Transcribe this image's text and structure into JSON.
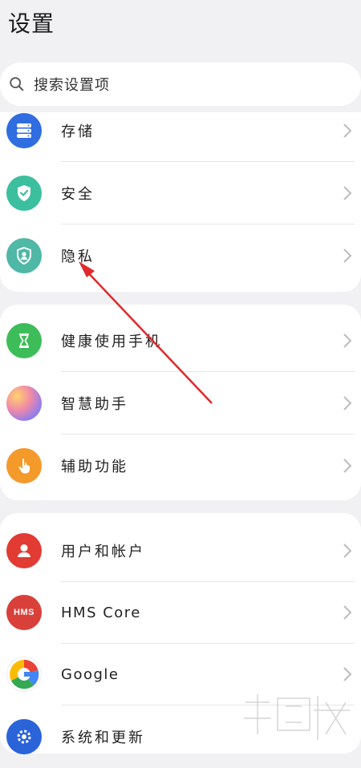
{
  "header": {
    "title": "设置"
  },
  "search": {
    "placeholder": "搜索设置项"
  },
  "groups": [
    {
      "items": [
        {
          "label": "存储",
          "icon": "storage-icon",
          "color": "#2f6de1"
        },
        {
          "label": "安全",
          "icon": "shield-check-icon",
          "color": "#3bbf9f"
        },
        {
          "label": "隐私",
          "icon": "privacy-shield-icon",
          "color": "#4fb8a6"
        }
      ]
    },
    {
      "items": [
        {
          "label": "健康使用手机",
          "icon": "hourglass-icon",
          "color": "#3dbd59"
        },
        {
          "label": "智慧助手",
          "icon": "assistant-orb-icon",
          "color": "#c78fe0"
        },
        {
          "label": "辅助功能",
          "icon": "hand-pointer-icon",
          "color": "#f39a2b"
        }
      ]
    },
    {
      "items": [
        {
          "label": "用户和帐户",
          "icon": "user-icon",
          "color": "#e13b34"
        },
        {
          "label": "HMS Core",
          "icon": "hms-logo-icon",
          "color": "#d9403a",
          "badge": "HMS"
        },
        {
          "label": "Google",
          "icon": "google-icon",
          "color": "#ffffff"
        },
        {
          "label": "系统和更新",
          "icon": "system-gear-icon",
          "color": "#2b63d9"
        }
      ]
    }
  ],
  "annotation": {
    "color": "#e0292b"
  }
}
